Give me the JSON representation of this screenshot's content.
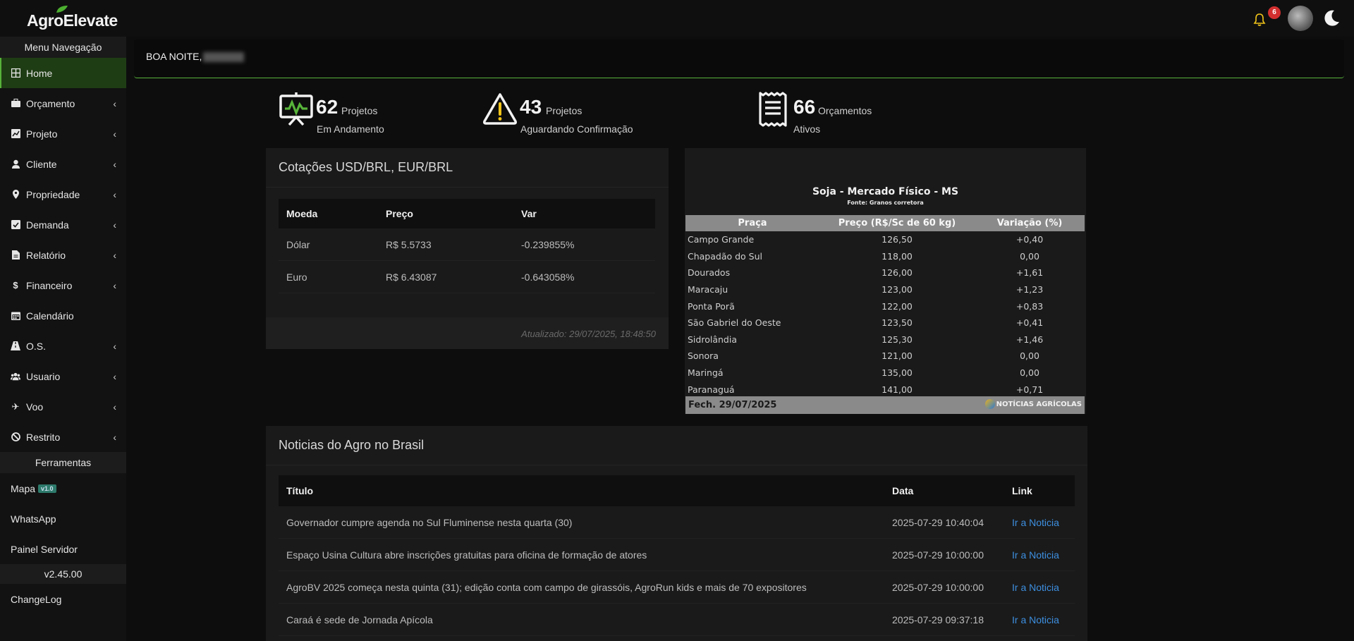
{
  "app": {
    "logo": "AgroElevate",
    "logo_sub": "agro"
  },
  "header": {
    "notifications_count": "6"
  },
  "sidebar": {
    "menu_title": "Menu Navegação",
    "items": [
      {
        "label": "Home",
        "icon": "grid-icon",
        "active": true
      },
      {
        "label": "Orçamento",
        "icon": "briefcase-icon"
      },
      {
        "label": "Projeto",
        "icon": "chart-icon"
      },
      {
        "label": "Cliente",
        "icon": "user-icon"
      },
      {
        "label": "Propriedade",
        "icon": "map-pin-icon"
      },
      {
        "label": "Demanda",
        "icon": "check-square-icon"
      },
      {
        "label": "Relatório",
        "icon": "file-icon"
      },
      {
        "label": "Financeiro",
        "icon": "dollar-icon"
      },
      {
        "label": "Calendário",
        "icon": "calendar-icon"
      },
      {
        "label": "O.S.",
        "icon": "road-icon"
      },
      {
        "label": "Usuario",
        "icon": "users-icon"
      },
      {
        "label": "Voo",
        "icon": "plane-icon"
      },
      {
        "label": "Restrito",
        "icon": "ban-icon"
      }
    ],
    "tools_title": "Ferramentas",
    "tools": [
      {
        "label": "Mapa",
        "tag": "v1.0"
      },
      {
        "label": "WhatsApp"
      },
      {
        "label": "Painel Servidor"
      }
    ],
    "version": "v2.45.00",
    "changelog": "ChangeLog"
  },
  "greeting": {
    "text": "BOA NOITE,"
  },
  "stats": [
    {
      "number": "62",
      "label1": "Projetos",
      "label2": "Em Andamento",
      "icon": "presentation-chart-icon"
    },
    {
      "number": "43",
      "label1": "Projetos",
      "label2": "Aguardando Confirmação",
      "icon": "warning-icon"
    },
    {
      "number": "66",
      "label1": "Orçamentos",
      "label2": "Ativos",
      "icon": "receipt-icon"
    }
  ],
  "fx": {
    "title": "Cotações USD/BRL, EUR/BRL",
    "headers": [
      "Moeda",
      "Preço",
      "Var"
    ],
    "rows": [
      [
        "Dólar",
        "R$ 5.5733",
        "-0.239855%"
      ],
      [
        "Euro",
        "R$ 6.43087",
        "-0.643058%"
      ]
    ],
    "updated": "Atualizado: 29/07/2025, 18:48:50"
  },
  "soja": {
    "title": "Soja - Mercado Físico - MS",
    "source": "Fonte: Granos corretora",
    "headers": [
      "Praça",
      "Preço (R$/Sc de 60 kg)",
      "Variação (%)"
    ],
    "rows": [
      [
        "Campo Grande",
        "126,50",
        "+0,40"
      ],
      [
        "Chapadão do Sul",
        "118,00",
        "0,00"
      ],
      [
        "Dourados",
        "126,00",
        "+1,61"
      ],
      [
        "Maracaju",
        "123,00",
        "+1,23"
      ],
      [
        "Ponta Porã",
        "122,00",
        "+0,83"
      ],
      [
        "São Gabriel do Oeste",
        "123,50",
        "+0,41"
      ],
      [
        "Sidrolândia",
        "125,30",
        "+1,46"
      ],
      [
        "Sonora",
        "121,00",
        "0,00"
      ],
      [
        "Maringá",
        "135,00",
        "0,00"
      ],
      [
        "Paranaguá",
        "141,00",
        "+0,71"
      ]
    ],
    "closing": "Fech. 29/07/2025",
    "brand": "NOTÍCIAS AGRÍCOLAS"
  },
  "news": {
    "title": "Noticias do Agro no Brasil",
    "headers": [
      "Título",
      "Data",
      "Link"
    ],
    "rows": [
      [
        "Governador cumpre agenda no Sul Fluminense nesta quarta (30)",
        "2025-07-29 10:40:04",
        "Ir a Noticia"
      ],
      [
        "Espaço Usina Cultura abre inscrições gratuitas para oficina de formação de atores",
        "2025-07-29 10:00:00",
        "Ir a Noticia"
      ],
      [
        "AgroBV 2025 começa nesta quinta (31); edição conta com campo de girassóis, AgroRun kids e mais de 70 expositores",
        "2025-07-29 10:00:00",
        "Ir a Noticia"
      ],
      [
        "Caraá é sede de Jornada Apícola",
        "2025-07-29 09:37:18",
        "Ir a Noticia"
      ]
    ]
  },
  "colors": {
    "accent": "#57b33a",
    "link": "#3d8fe0",
    "badge": "#d32f2f"
  }
}
